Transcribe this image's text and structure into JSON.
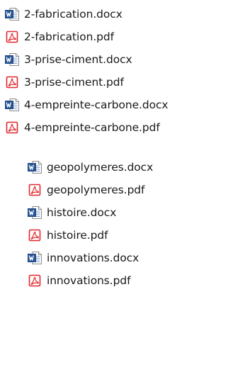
{
  "colors": {
    "word_blue": "#2b5797",
    "word_blue_dark": "#1e4582",
    "pdf_red": "#e0282e",
    "text": "#1a1a1a"
  },
  "files": [
    {
      "name": "2-fabrication.docx",
      "type": "docx",
      "icon": "word-document-icon"
    },
    {
      "name": "2-fabrication.pdf",
      "type": "pdf",
      "icon": "pdf-document-icon"
    },
    {
      "name": "3-prise-ciment.docx",
      "type": "docx",
      "icon": "word-document-icon"
    },
    {
      "name": "3-prise-ciment.pdf",
      "type": "pdf",
      "icon": "pdf-document-icon"
    },
    {
      "name": "4-empreinte-carbone.docx",
      "type": "docx",
      "icon": "word-document-icon"
    },
    {
      "name": "4-empreinte-carbone.pdf",
      "type": "pdf",
      "icon": "pdf-document-icon"
    },
    {
      "name": "geopolymeres.docx",
      "type": "docx",
      "icon": "word-document-icon"
    },
    {
      "name": "geopolymeres.pdf",
      "type": "pdf",
      "icon": "pdf-document-icon"
    },
    {
      "name": "histoire.docx",
      "type": "docx",
      "icon": "word-document-icon"
    },
    {
      "name": "histoire.pdf",
      "type": "pdf",
      "icon": "pdf-document-icon"
    },
    {
      "name": "innovations.docx",
      "type": "docx",
      "icon": "word-document-icon"
    },
    {
      "name": "innovations.pdf",
      "type": "pdf",
      "icon": "pdf-document-icon"
    }
  ]
}
